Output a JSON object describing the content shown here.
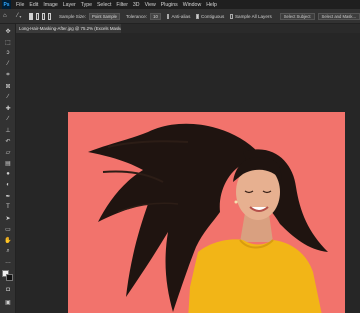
{
  "menubar": {
    "logo": "Ps",
    "items": [
      "File",
      "Edit",
      "Image",
      "Layer",
      "Type",
      "Select",
      "Filter",
      "3D",
      "View",
      "Plugins",
      "Window",
      "Help"
    ]
  },
  "options": {
    "sample_size_label": "Sample Size:",
    "sample_size_value": "Point Sample",
    "tolerance_label": "Tolerance:",
    "tolerance_value": "10",
    "anti_alias_label": "Anti-alias",
    "contiguous_label": "Contiguous",
    "sample_all_layers_label": "Sample All Layers",
    "select_subject_label": "Select Subject",
    "select_mask_label": "Select and Mask..."
  },
  "document": {
    "tab_title": "Long-Hair-Masking-After.jpg @ 75.2% (Excels Mask/8) *"
  },
  "colors": {
    "canvas_background": "#f2736c",
    "shirt": "#f2b517",
    "hair": "#1f1410",
    "skin": "#e7b090"
  },
  "icons": {
    "home": "home-icon",
    "tool_preset": "magic-wand-icon",
    "tools": [
      "move-icon",
      "marquee-icon",
      "lasso-icon",
      "magic-wand-icon",
      "crop-icon",
      "frame-icon",
      "eyedropper-icon",
      "healing-icon",
      "brush-icon",
      "stamp-icon",
      "history-brush-icon",
      "eraser-icon",
      "gradient-icon",
      "blur-icon",
      "dodge-icon",
      "pen-icon",
      "type-icon",
      "path-select-icon",
      "shape-icon",
      "hand-icon",
      "zoom-icon",
      "more-icon"
    ]
  }
}
